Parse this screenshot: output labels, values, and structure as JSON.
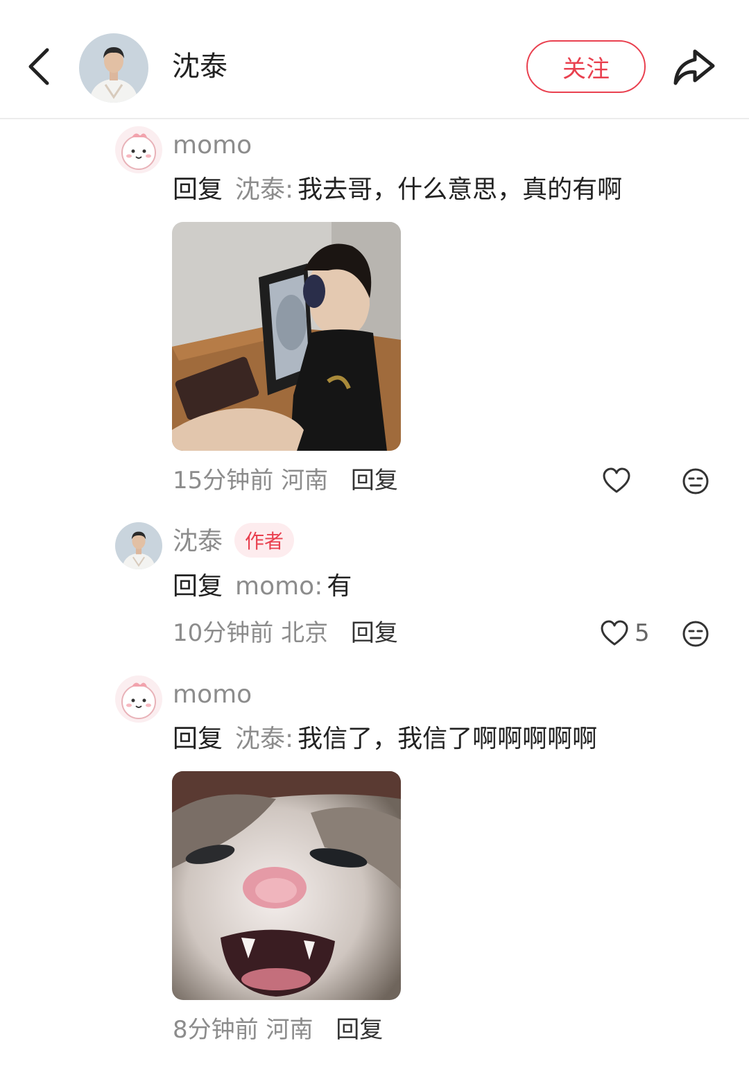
{
  "header": {
    "username": "沈泰",
    "follow_label": "关注",
    "back_icon": "chevron-left-icon",
    "share_icon": "share-arrow-icon"
  },
  "comments": [
    {
      "username": "momo",
      "reply_keyword": "回复",
      "reply_target": "沈泰:",
      "text": "我去哥，什么意思，真的有啊",
      "image": "meme-man-inside-monitor",
      "time": "15分钟前",
      "location": "河南",
      "reply_label": "回复",
      "likes": ""
    },
    {
      "username": "沈泰",
      "badge": "作者",
      "reply_keyword": "回复",
      "reply_target": "momo:",
      "text": "有",
      "time": "10分钟前",
      "location": "北京",
      "reply_label": "回复",
      "likes": "5"
    },
    {
      "username": "momo",
      "reply_keyword": "回复",
      "reply_target": "沈泰:",
      "text": "我信了，我信了啊啊啊啊啊",
      "image": "meme-screaming-cat",
      "time": "8分钟前",
      "location": "河南",
      "reply_label": "回复"
    }
  ],
  "colors": {
    "accent": "#e9404f",
    "muted_text": "#8c8c8c",
    "badge_bg": "#fdecee"
  }
}
